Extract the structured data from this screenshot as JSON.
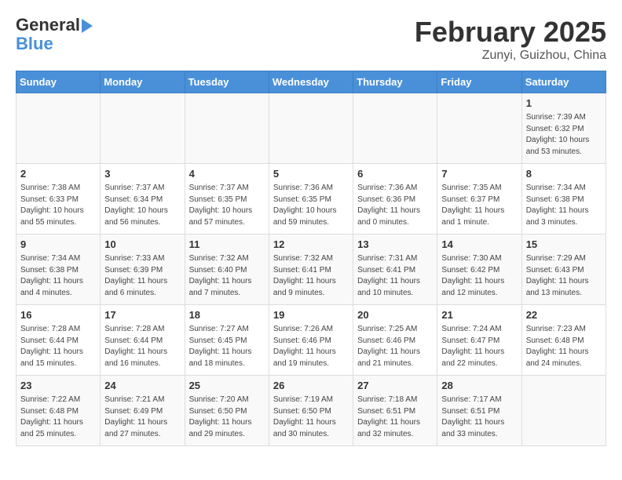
{
  "logo": {
    "line1": "General",
    "line2": "Blue"
  },
  "title": "February 2025",
  "subtitle": "Zunyi, Guizhou, China",
  "days_of_week": [
    "Sunday",
    "Monday",
    "Tuesday",
    "Wednesday",
    "Thursday",
    "Friday",
    "Saturday"
  ],
  "weeks": [
    [
      {
        "day": "",
        "info": ""
      },
      {
        "day": "",
        "info": ""
      },
      {
        "day": "",
        "info": ""
      },
      {
        "day": "",
        "info": ""
      },
      {
        "day": "",
        "info": ""
      },
      {
        "day": "",
        "info": ""
      },
      {
        "day": "1",
        "info": "Sunrise: 7:39 AM\nSunset: 6:32 PM\nDaylight: 10 hours\nand 53 minutes."
      }
    ],
    [
      {
        "day": "2",
        "info": "Sunrise: 7:38 AM\nSunset: 6:33 PM\nDaylight: 10 hours\nand 55 minutes."
      },
      {
        "day": "3",
        "info": "Sunrise: 7:37 AM\nSunset: 6:34 PM\nDaylight: 10 hours\nand 56 minutes."
      },
      {
        "day": "4",
        "info": "Sunrise: 7:37 AM\nSunset: 6:35 PM\nDaylight: 10 hours\nand 57 minutes."
      },
      {
        "day": "5",
        "info": "Sunrise: 7:36 AM\nSunset: 6:35 PM\nDaylight: 10 hours\nand 59 minutes."
      },
      {
        "day": "6",
        "info": "Sunrise: 7:36 AM\nSunset: 6:36 PM\nDaylight: 11 hours\nand 0 minutes."
      },
      {
        "day": "7",
        "info": "Sunrise: 7:35 AM\nSunset: 6:37 PM\nDaylight: 11 hours\nand 1 minute."
      },
      {
        "day": "8",
        "info": "Sunrise: 7:34 AM\nSunset: 6:38 PM\nDaylight: 11 hours\nand 3 minutes."
      }
    ],
    [
      {
        "day": "9",
        "info": "Sunrise: 7:34 AM\nSunset: 6:38 PM\nDaylight: 11 hours\nand 4 minutes."
      },
      {
        "day": "10",
        "info": "Sunrise: 7:33 AM\nSunset: 6:39 PM\nDaylight: 11 hours\nand 6 minutes."
      },
      {
        "day": "11",
        "info": "Sunrise: 7:32 AM\nSunset: 6:40 PM\nDaylight: 11 hours\nand 7 minutes."
      },
      {
        "day": "12",
        "info": "Sunrise: 7:32 AM\nSunset: 6:41 PM\nDaylight: 11 hours\nand 9 minutes."
      },
      {
        "day": "13",
        "info": "Sunrise: 7:31 AM\nSunset: 6:41 PM\nDaylight: 11 hours\nand 10 minutes."
      },
      {
        "day": "14",
        "info": "Sunrise: 7:30 AM\nSunset: 6:42 PM\nDaylight: 11 hours\nand 12 minutes."
      },
      {
        "day": "15",
        "info": "Sunrise: 7:29 AM\nSunset: 6:43 PM\nDaylight: 11 hours\nand 13 minutes."
      }
    ],
    [
      {
        "day": "16",
        "info": "Sunrise: 7:28 AM\nSunset: 6:44 PM\nDaylight: 11 hours\nand 15 minutes."
      },
      {
        "day": "17",
        "info": "Sunrise: 7:28 AM\nSunset: 6:44 PM\nDaylight: 11 hours\nand 16 minutes."
      },
      {
        "day": "18",
        "info": "Sunrise: 7:27 AM\nSunset: 6:45 PM\nDaylight: 11 hours\nand 18 minutes."
      },
      {
        "day": "19",
        "info": "Sunrise: 7:26 AM\nSunset: 6:46 PM\nDaylight: 11 hours\nand 19 minutes."
      },
      {
        "day": "20",
        "info": "Sunrise: 7:25 AM\nSunset: 6:46 PM\nDaylight: 11 hours\nand 21 minutes."
      },
      {
        "day": "21",
        "info": "Sunrise: 7:24 AM\nSunset: 6:47 PM\nDaylight: 11 hours\nand 22 minutes."
      },
      {
        "day": "22",
        "info": "Sunrise: 7:23 AM\nSunset: 6:48 PM\nDaylight: 11 hours\nand 24 minutes."
      }
    ],
    [
      {
        "day": "23",
        "info": "Sunrise: 7:22 AM\nSunset: 6:48 PM\nDaylight: 11 hours\nand 25 minutes."
      },
      {
        "day": "24",
        "info": "Sunrise: 7:21 AM\nSunset: 6:49 PM\nDaylight: 11 hours\nand 27 minutes."
      },
      {
        "day": "25",
        "info": "Sunrise: 7:20 AM\nSunset: 6:50 PM\nDaylight: 11 hours\nand 29 minutes."
      },
      {
        "day": "26",
        "info": "Sunrise: 7:19 AM\nSunset: 6:50 PM\nDaylight: 11 hours\nand 30 minutes."
      },
      {
        "day": "27",
        "info": "Sunrise: 7:18 AM\nSunset: 6:51 PM\nDaylight: 11 hours\nand 32 minutes."
      },
      {
        "day": "28",
        "info": "Sunrise: 7:17 AM\nSunset: 6:51 PM\nDaylight: 11 hours\nand 33 minutes."
      },
      {
        "day": "",
        "info": ""
      }
    ]
  ]
}
